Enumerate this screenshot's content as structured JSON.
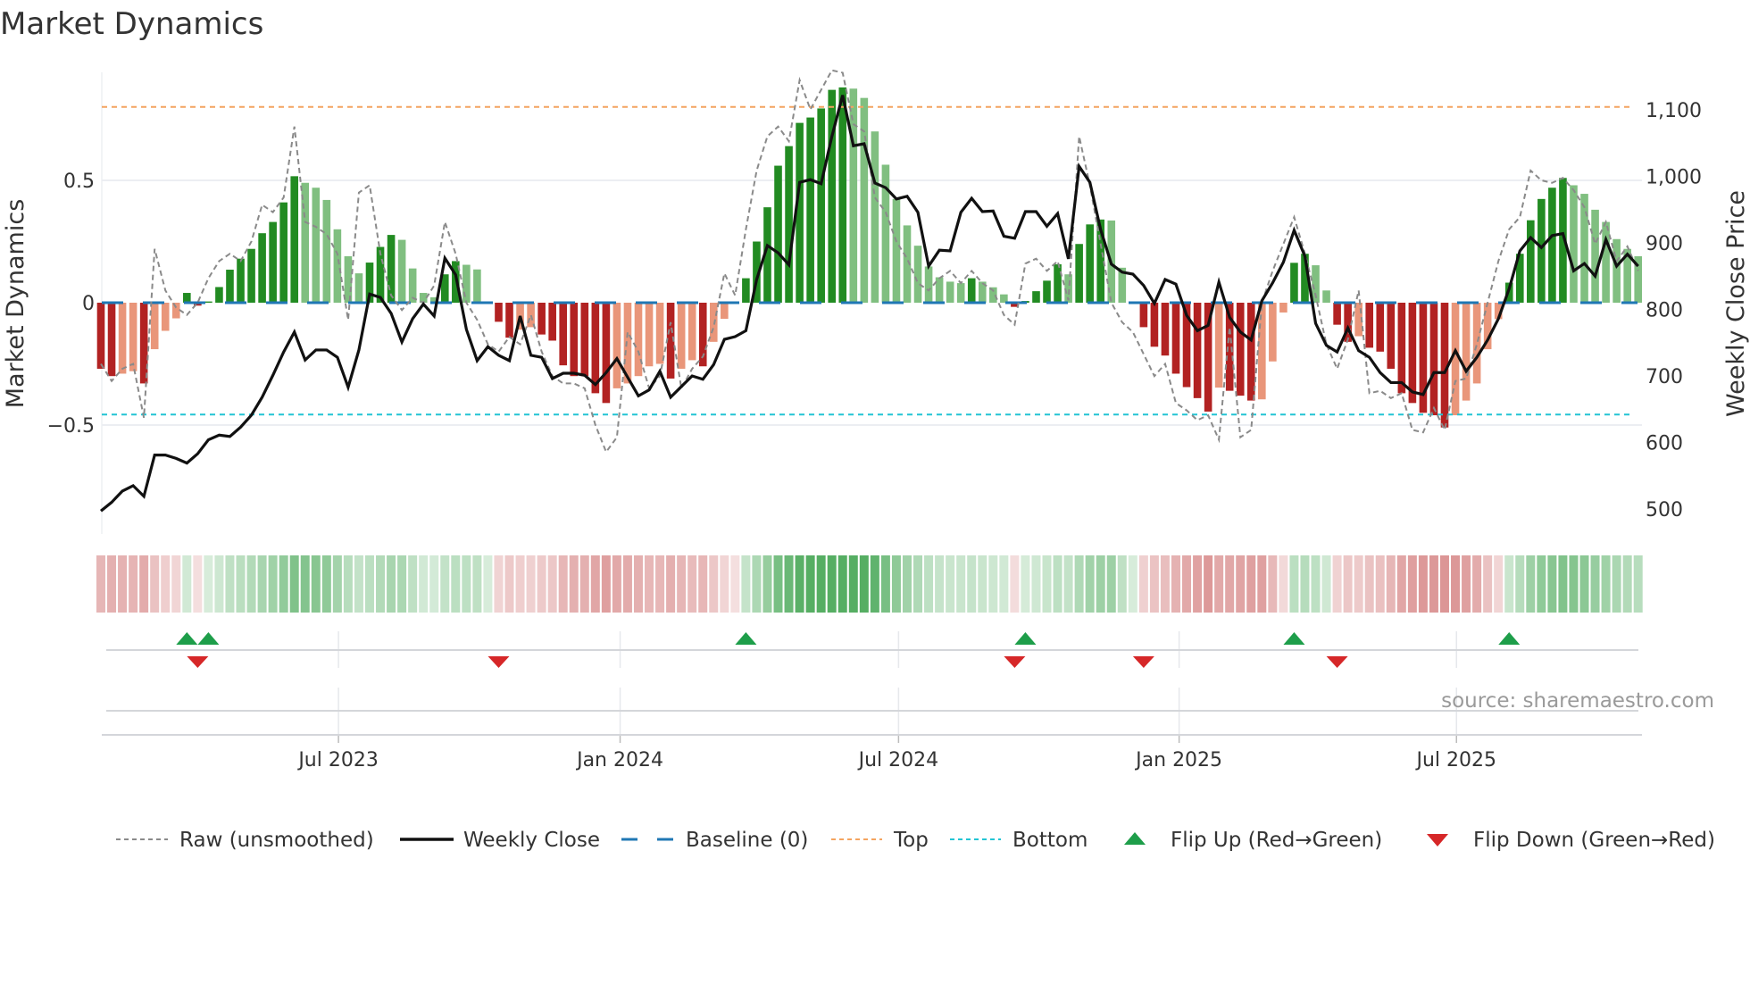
{
  "title": "Market Dynamics",
  "source": "source: sharemaestro.com",
  "chart_data": {
    "type": "bar",
    "title": "Market Dynamics",
    "ylabel": "Market Dynamics",
    "y2label": "Weekly Close Price",
    "x_unit": "week index (weekly bars)",
    "ylim": [
      -0.76,
      0.95
    ],
    "y2lim": [
      465,
      1145
    ],
    "yticks": [
      {
        "v": 0.5,
        "label": "0.5"
      },
      {
        "v": 0,
        "label": "0"
      },
      {
        "v": -0.5,
        "label": "−0.5"
      }
    ],
    "y2ticks": [
      {
        "v": 1100,
        "label": "1,100"
      },
      {
        "v": 1000,
        "label": "1,000"
      },
      {
        "v": 900,
        "label": "900"
      },
      {
        "v": 800,
        "label": "800"
      },
      {
        "v": 700,
        "label": "700"
      },
      {
        "v": 600,
        "label": "600"
      },
      {
        "v": 500,
        "label": "500"
      }
    ],
    "xticks": [
      {
        "x": 22.1,
        "label": "Jul 2023"
      },
      {
        "x": 48.3,
        "label": "Jan 2024"
      },
      {
        "x": 74.2,
        "label": "Jul 2024"
      },
      {
        "x": 100.3,
        "label": "Jan 2025"
      },
      {
        "x": 126.1,
        "label": "Jul 2025"
      }
    ],
    "top_level": 0.8,
    "bottom_level": -0.457,
    "baseline": 0,
    "colors": {
      "up_strong": "#228b22",
      "up_weak": "#80bf80",
      "down_strong": "#b22222",
      "down_weak": "#e9967a",
      "raw": "#8a8a8a",
      "close": "#111111",
      "baseline": "#1f77b4",
      "top": "#f4a460",
      "bottom": "#22c4d4",
      "flip_up": "#1e9e4a",
      "flip_down": "#d62728"
    },
    "momentum": [
      -0.27,
      -0.3,
      -0.29,
      -0.28,
      -0.33,
      -0.19,
      -0.115,
      -0.064,
      0.04,
      -0.012,
      0.005,
      0.064,
      0.135,
      0.18,
      0.22,
      0.284,
      0.33,
      0.41,
      0.517,
      0.49,
      0.47,
      0.42,
      0.3,
      0.19,
      0.12,
      0.164,
      0.228,
      0.277,
      0.257,
      0.14,
      0.04,
      0.022,
      0.116,
      0.17,
      0.155,
      0.136,
      0.002,
      -0.078,
      -0.143,
      -0.11,
      -0.1,
      -0.13,
      -0.155,
      -0.256,
      -0.3,
      -0.3,
      -0.37,
      -0.41,
      -0.35,
      -0.33,
      -0.3,
      -0.26,
      -0.25,
      -0.31,
      -0.27,
      -0.235,
      -0.26,
      -0.16,
      -0.066,
      -0.005,
      0.1,
      0.25,
      0.39,
      0.56,
      0.64,
      0.735,
      0.757,
      0.794,
      0.87,
      0.88,
      0.875,
      0.837,
      0.7,
      0.564,
      0.424,
      0.316,
      0.233,
      0.148,
      0.104,
      0.086,
      0.08,
      0.1,
      0.086,
      0.063,
      0.034,
      -0.017,
      0.007,
      0.047,
      0.09,
      0.157,
      0.116,
      0.24,
      0.32,
      0.34,
      0.336,
      0.143,
      0.003,
      -0.1,
      -0.18,
      -0.216,
      -0.29,
      -0.345,
      -0.39,
      -0.445,
      -0.347,
      -0.36,
      -0.38,
      -0.4,
      -0.395,
      -0.24,
      -0.04,
      0.163,
      0.2,
      0.153,
      0.05,
      -0.09,
      -0.16,
      -0.137,
      -0.184,
      -0.2,
      -0.27,
      -0.37,
      -0.41,
      -0.45,
      -0.46,
      -0.51,
      -0.46,
      -0.4,
      -0.33,
      -0.19,
      -0.067,
      0.082,
      0.2,
      0.337,
      0.424,
      0.47,
      0.51,
      0.48,
      0.445,
      0.38,
      0.33,
      0.26,
      0.22,
      0.19
    ],
    "raw": [
      -0.25,
      -0.32,
      -0.27,
      -0.25,
      -0.47,
      0.22,
      0.05,
      -0.02,
      -0.05,
      0.0,
      0.1,
      0.17,
      0.2,
      0.17,
      0.25,
      0.4,
      0.37,
      0.43,
      0.72,
      0.33,
      0.31,
      0.28,
      0.2,
      -0.07,
      0.45,
      0.48,
      0.2,
      0.03,
      -0.03,
      0.02,
      0.0,
      0.07,
      0.33,
      0.2,
      0.0,
      -0.07,
      -0.17,
      -0.2,
      -0.14,
      -0.17,
      -0.05,
      -0.2,
      -0.3,
      -0.33,
      -0.33,
      -0.35,
      -0.5,
      -0.61,
      -0.55,
      -0.12,
      -0.2,
      -0.35,
      -0.3,
      -0.08,
      -0.35,
      -0.27,
      -0.22,
      -0.1,
      0.12,
      0.03,
      0.3,
      0.54,
      0.68,
      0.72,
      0.66,
      0.91,
      0.79,
      0.87,
      0.95,
      0.94,
      0.73,
      0.7,
      0.43,
      0.37,
      0.25,
      0.18,
      0.08,
      0.05,
      0.1,
      0.13,
      0.08,
      0.13,
      0.08,
      0.05,
      -0.05,
      -0.09,
      0.16,
      0.18,
      0.13,
      0.17,
      0.01,
      0.68,
      0.48,
      0.24,
      0.0,
      -0.08,
      -0.12,
      -0.21,
      -0.3,
      -0.25,
      -0.41,
      -0.44,
      -0.48,
      -0.46,
      -0.56,
      -0.1,
      -0.55,
      -0.52,
      0.0,
      0.13,
      0.24,
      0.35,
      0.2,
      0.03,
      -0.17,
      -0.27,
      -0.15,
      0.05,
      -0.37,
      -0.36,
      -0.39,
      -0.37,
      -0.52,
      -0.53,
      -0.43,
      -0.52,
      -0.32,
      -0.31,
      -0.17,
      0.0,
      0.17,
      0.3,
      0.35,
      0.54,
      0.5,
      0.49,
      0.51,
      0.46,
      0.39,
      0.24,
      0.33,
      0.17,
      0.23,
      0.13
    ],
    "close": [
      497,
      510,
      527,
      535,
      519,
      581,
      581,
      576,
      569,
      583,
      604,
      611,
      609,
      623,
      641,
      668,
      701,
      736,
      766,
      724,
      739,
      739,
      728,
      683,
      739,
      823,
      818,
      794,
      751,
      786,
      808,
      790,
      877,
      852,
      770,
      723,
      744,
      731,
      723,
      790,
      731,
      728,
      696,
      704,
      704,
      701,
      687,
      705,
      726,
      698,
      670,
      679,
      707,
      668,
      684,
      700,
      695,
      717,
      755,
      759,
      768,
      845,
      896,
      885,
      867,
      991,
      995,
      989,
      1060,
      1122,
      1046,
      1049,
      990,
      983,
      966,
      970,
      946,
      865,
      889,
      888,
      946,
      967,
      947,
      948,
      910,
      907,
      947,
      947,
      925,
      944,
      876,
      1015,
      991,
      920,
      868,
      856,
      853,
      836,
      809,
      845,
      838,
      791,
      768,
      776,
      841,
      788,
      766,
      754,
      813,
      840,
      871,
      919,
      880,
      779,
      746,
      736,
      772,
      738,
      728,
      705,
      690,
      690,
      676,
      672,
      705,
      705,
      738,
      707,
      728,
      754,
      786,
      831,
      888,
      908,
      893,
      911,
      914,
      858,
      869,
      850,
      905,
      865,
      883,
      865
    ],
    "flip_up": [
      8,
      10,
      60,
      86,
      111,
      131
    ],
    "flip_down": [
      9,
      37,
      85,
      97,
      115
    ],
    "legend_position": "bottom",
    "legend": [
      {
        "key": "raw",
        "label": "Raw (unsmoothed)"
      },
      {
        "key": "close",
        "label": "Weekly Close"
      },
      {
        "key": "baseline",
        "label": "Baseline (0)"
      },
      {
        "key": "top",
        "label": "Top"
      },
      {
        "key": "bottom",
        "label": "Bottom"
      },
      {
        "key": "flip_up",
        "label": "Flip Up (Red→Green)"
      },
      {
        "key": "flip_down",
        "label": "Flip Down (Green→Red)"
      }
    ]
  }
}
